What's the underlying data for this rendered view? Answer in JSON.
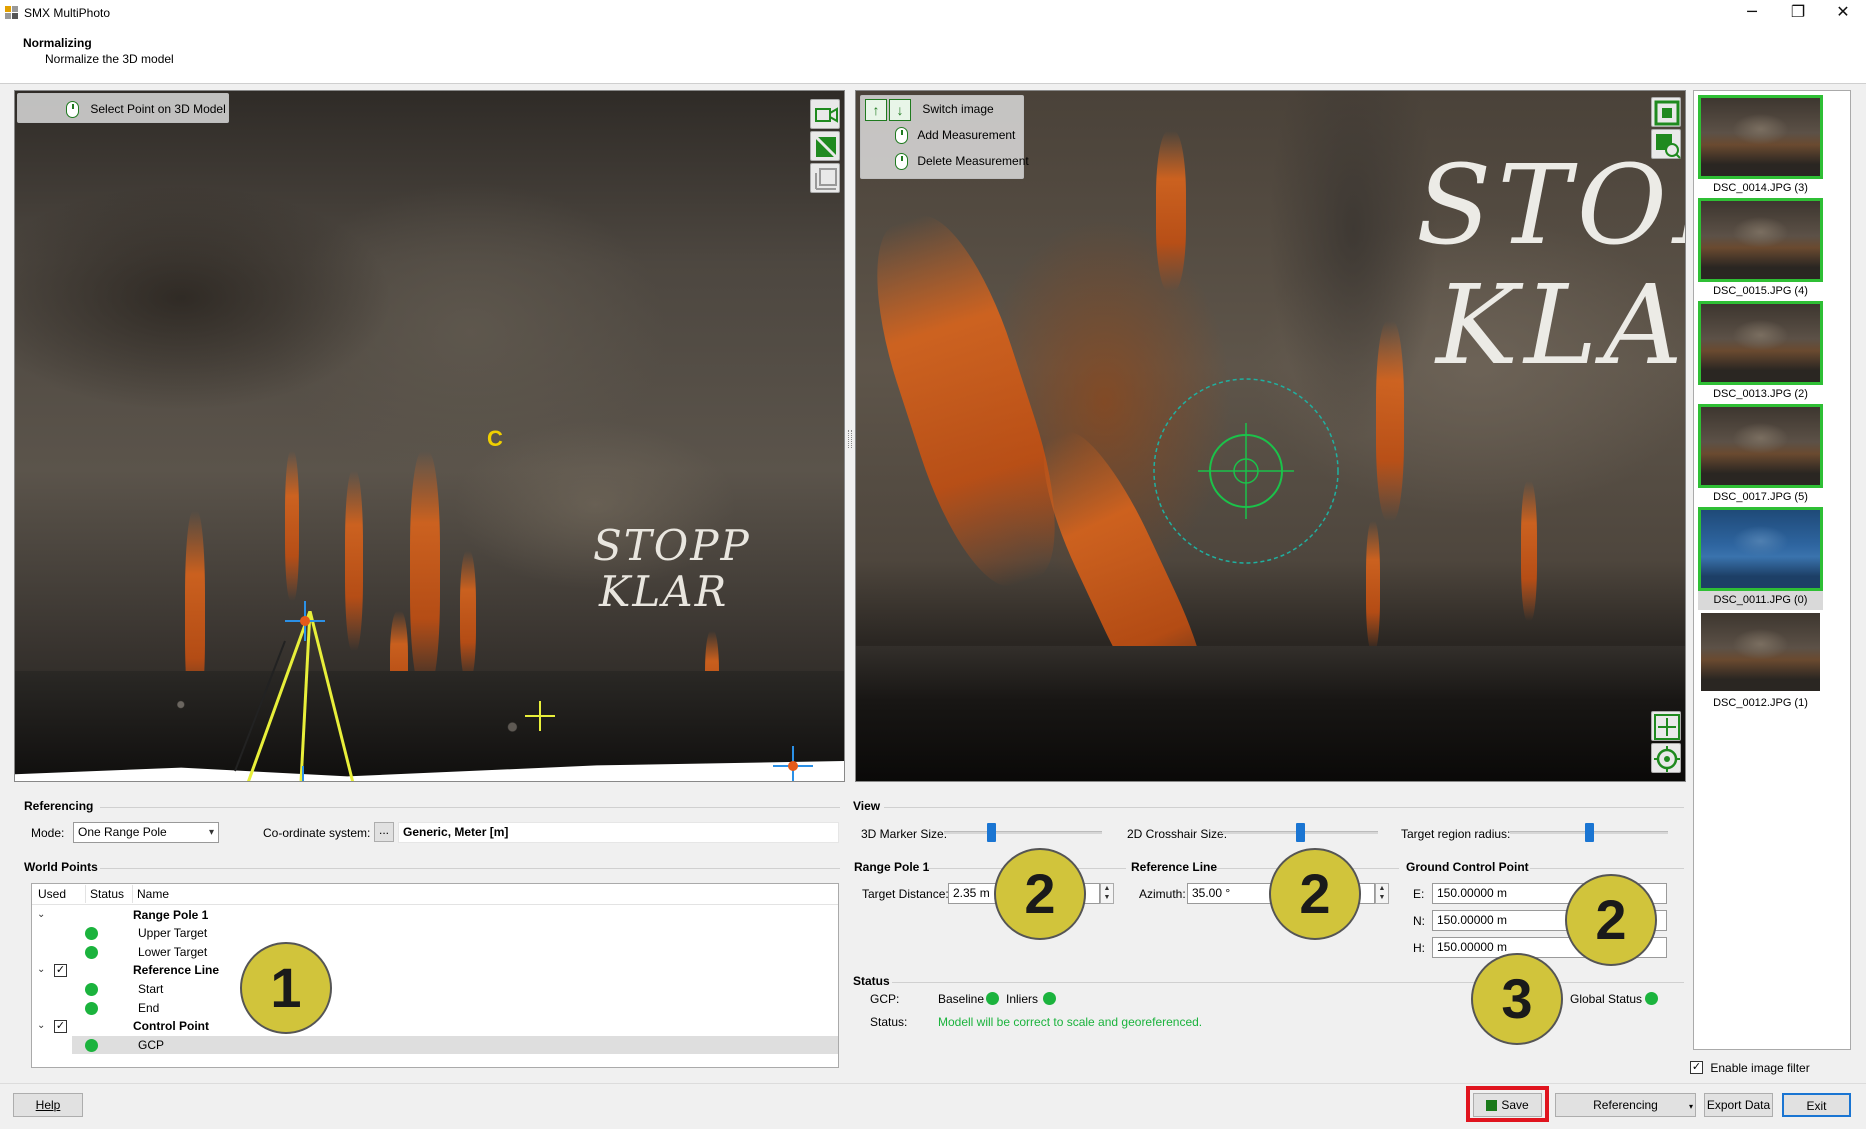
{
  "window": {
    "title": "SMX MultiPhoto",
    "minimize_glyph": "─",
    "restore_glyph": "❐",
    "close_glyph": "✕"
  },
  "header": {
    "title": "Normalizing",
    "subtitle": "Normalize the 3D model"
  },
  "view3d": {
    "tool_hint": "Select Point on 3D Model",
    "wall_text_line1": "STOPP",
    "wall_text_line2": "KLAR",
    "marker_c": "C",
    "side_tools": [
      "camera-icon",
      "crop-icon",
      "frame-icon"
    ]
  },
  "view2d": {
    "switch_label": "Switch image",
    "add_label": "Add Measurement",
    "delete_label": "Delete Measurement",
    "wall_text_line1": "STOP",
    "wall_text_line2": "KLA",
    "side_tools": [
      "fit-to-view-icon",
      "zoom-region-icon",
      "add-point-icon",
      "center-target-icon"
    ]
  },
  "thumbnails": [
    {
      "caption": "DSC_0014.JPG (3)",
      "framed": true,
      "selected": false
    },
    {
      "caption": "DSC_0015.JPG (4)",
      "framed": true,
      "selected": false
    },
    {
      "caption": "DSC_0013.JPG (2)",
      "framed": true,
      "selected": false
    },
    {
      "caption": "DSC_0017.JPG (5)",
      "framed": true,
      "selected": false
    },
    {
      "caption": "DSC_0011.JPG (0)",
      "framed": true,
      "selected": true
    },
    {
      "caption": "DSC_0012.JPG (1)",
      "framed": false,
      "selected": false
    }
  ],
  "referencing": {
    "title": "Referencing",
    "mode_label": "Mode:",
    "mode_value": "One Range Pole",
    "coord_label": "Co-ordinate system:",
    "coord_button": "...",
    "coord_value": "Generic, Meter [m]"
  },
  "world_points": {
    "title": "World Points",
    "columns": [
      "Used",
      "Status",
      "Name"
    ],
    "rows": [
      {
        "name": "Range Pole 1",
        "bold": true
      },
      {
        "name": "Upper Target",
        "bold": false
      },
      {
        "name": "Lower Target",
        "bold": false
      },
      {
        "name": "Reference Line",
        "bold": true
      },
      {
        "name": "Start",
        "bold": false
      },
      {
        "name": "End",
        "bold": false
      },
      {
        "name": "Control Point",
        "bold": true
      },
      {
        "name": "GCP",
        "bold": false
      }
    ]
  },
  "view_settings": {
    "title": "View",
    "marker_label": "3D Marker Size:",
    "marker_value": 0.3,
    "crosshair_label": "2D Crosshair Size:",
    "crosshair_value": 0.5,
    "radius_label": "Target region radius:",
    "radius_value": 0.5
  },
  "range_pole": {
    "title": "Range Pole 1",
    "distance_label": "Target Distance:",
    "distance_value": "2.35 m"
  },
  "reference_line": {
    "title": "Reference Line",
    "azimuth_label": "Azimuth:",
    "azimuth_value": "35.00 °"
  },
  "gcp": {
    "title": "Ground Control Point",
    "e_label": "E:",
    "e_value": "150.00000 m",
    "n_label": "N:",
    "n_value": "150.00000 m",
    "h_label": "H:",
    "h_value": "150.00000 m"
  },
  "status": {
    "title": "Status",
    "gcp_label": "GCP:",
    "baseline_label": "Baseline",
    "inliers_label": "Inliers",
    "global_label": "Global Status",
    "status_label": "Status:",
    "status_message": "Modell will be correct to scale and georeferenced.",
    "ok_color": "#1bb33d"
  },
  "badges": [
    "1",
    "2",
    "2",
    "2",
    "3"
  ],
  "thumb_filter_label": "Enable image filter",
  "footer": {
    "help": "Help",
    "save": "Save",
    "referencing": "Referencing",
    "export": "Export Data",
    "exit": "Exit"
  },
  "colors": {
    "accent_blue": "#1a75d2",
    "frame_green": "#2fbf35",
    "badge_yellow": "#d1c43b",
    "highlight_red": "#e0141e"
  }
}
